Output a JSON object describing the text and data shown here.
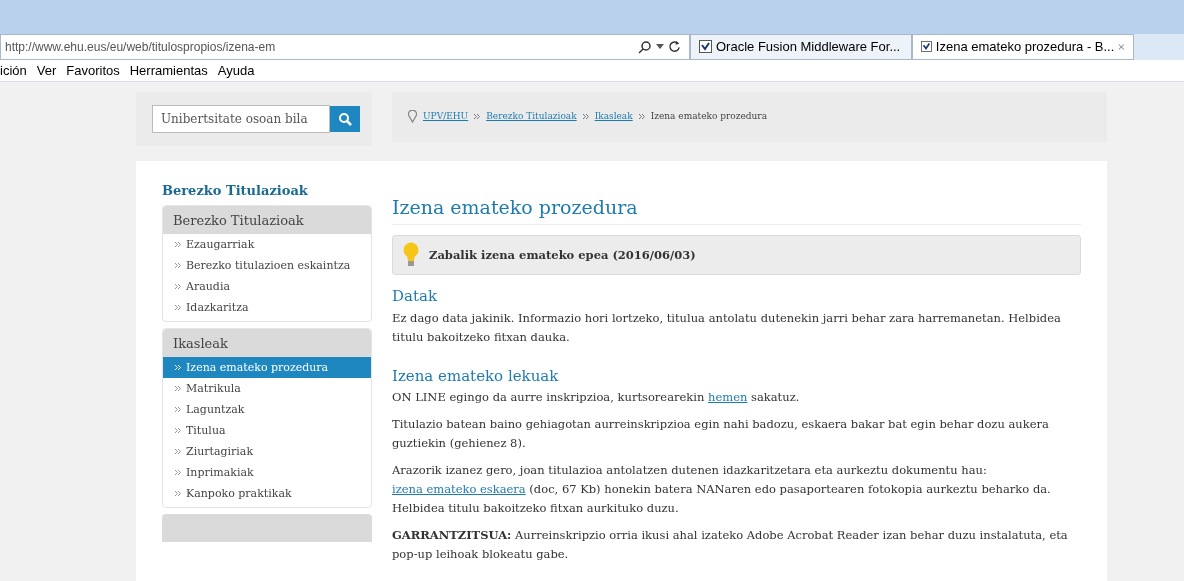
{
  "browser": {
    "address": "http://www.ehu.eus/eu/web/titulospropios/izena-em",
    "tabs": [
      {
        "label": "Oracle Fusion Middleware For...",
        "selected": false,
        "closable": false
      },
      {
        "label": "Izena emateko prozedura - B...",
        "selected": true,
        "closable": true
      }
    ],
    "menu": [
      "ición",
      "Ver",
      "Favoritos",
      "Herramientas",
      "Ayuda"
    ]
  },
  "search": {
    "placeholder": "Unibertsitate osoan bila"
  },
  "breadcrumb": [
    {
      "label": "UPV/EHU",
      "kind": "link"
    },
    {
      "label": "Berezko Titulazioak",
      "kind": "link"
    },
    {
      "label": "Ikasleak",
      "kind": "link"
    },
    {
      "label": "Izena emateko prozedura",
      "kind": "current"
    }
  ],
  "sidebar": {
    "title": "Berezko Titulazioak",
    "sections": [
      {
        "header": "Berezko Titulazioak",
        "items": [
          {
            "label": "Ezaugarriak",
            "selected": false
          },
          {
            "label": "Berezko titulazioen eskaintza",
            "selected": false
          },
          {
            "label": "Araudia",
            "selected": false
          },
          {
            "label": "Idazkaritza",
            "selected": false
          }
        ]
      },
      {
        "header": "Ikasleak",
        "items": [
          {
            "label": "Izena emateko prozedura",
            "selected": true
          },
          {
            "label": "Matrikula",
            "selected": false
          },
          {
            "label": "Laguntzak",
            "selected": false
          },
          {
            "label": "Titulua",
            "selected": false
          },
          {
            "label": "Ziurtagiriak",
            "selected": false
          },
          {
            "label": "Inprimakiak",
            "selected": false
          },
          {
            "label": "Kanpoko praktikak",
            "selected": false
          }
        ]
      }
    ]
  },
  "content": {
    "title": "Izena emateko prozedura",
    "notice": "Zabalik izena emateko epea (2016/06/03)",
    "blocks": [
      {
        "kind": "heading",
        "text": "Datak"
      },
      {
        "kind": "paragraph",
        "parts": [
          {
            "kind": "text",
            "text": "Ez dago data jakinik. Informazio hori lortzeko, titulua antolatu dutenekin jarri behar zara harremanetan. Helbidea titulu bakoitzeko fitxan dauka."
          }
        ]
      },
      {
        "kind": "heading",
        "text": "Izena emateko lekuak"
      },
      {
        "kind": "paragraph",
        "parts": [
          {
            "kind": "text",
            "text": "ON LINE egingo da aurre inskripzioa, kurtsorearekin "
          },
          {
            "kind": "link",
            "text": "hemen"
          },
          {
            "kind": "text",
            "text": " sakatuz."
          }
        ]
      },
      {
        "kind": "paragraph",
        "parts": [
          {
            "kind": "text",
            "text": "Titulazio batean baino gehiagotan aurreinskripzioa egin nahi badozu, eskaera bakar bat egin behar dozu aukera guztiekin (gehienez 8)."
          }
        ]
      },
      {
        "kind": "paragraph",
        "parts": [
          {
            "kind": "text",
            "text": "Arazorik izanez gero, joan titulazioa antolatzen dutenen idazkaritzetara eta aurkeztu dokumentu hau: "
          },
          {
            "kind": "link",
            "text": "izena emateko eskaera"
          },
          {
            "kind": "text",
            "text": " (doc, 67 Kb) honekin batera NANaren edo pasaportearen fotokopia aurkeztu beharko da. Helbidea titulu bakoitzeko fitxan aurkituko duzu."
          }
        ]
      },
      {
        "kind": "paragraph",
        "parts": [
          {
            "kind": "text",
            "text": "**GARRANTZITSUA:**  Aurreinskripzio orria ikusi ahal izateko Adobe Acrobat Reader izan behar duzu instalatuta, eta pop-up leihoak blokeatu gabe."
          }
        ]
      }
    ]
  }
}
